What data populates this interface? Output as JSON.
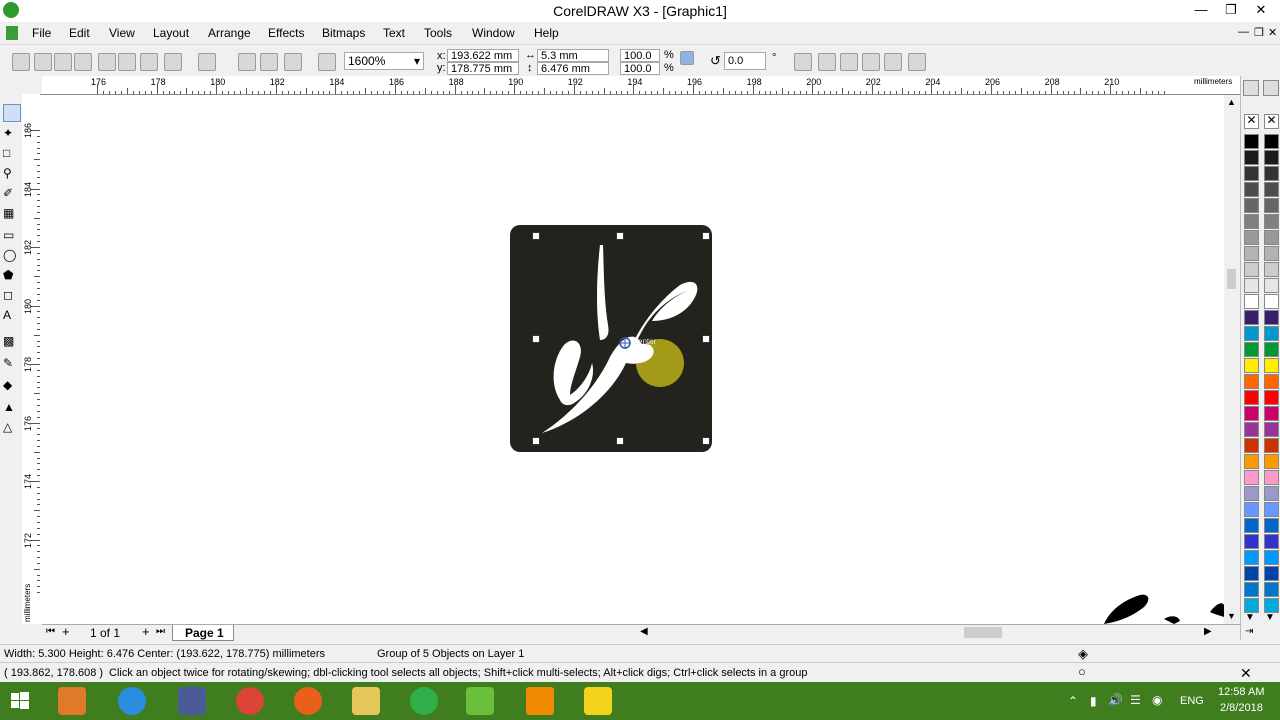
{
  "window": {
    "title": "CorelDRAW X3 - [Graphic1]"
  },
  "menu": [
    "File",
    "Edit",
    "View",
    "Layout",
    "Arrange",
    "Effects",
    "Bitmaps",
    "Text",
    "Tools",
    "Window",
    "Help"
  ],
  "toolbar": {
    "zoom": "1600%",
    "x_label": "x:",
    "x_value": "193.622 mm",
    "y_label": "y:",
    "y_value": "178.775 mm",
    "width_value": "5.3 mm",
    "height_value": "6.476 mm",
    "scale_x": "100.0",
    "scale_y": "100.0",
    "percent": "%",
    "rotation": "0.0",
    "degree": "°"
  },
  "ruler": {
    "unit": "millimeters",
    "h_labels": [
      "176",
      "178",
      "180",
      "182",
      "184",
      "186",
      "188",
      "190",
      "192",
      "194",
      "196",
      "198",
      "200",
      "202",
      "204",
      "206",
      "208",
      "210"
    ],
    "v_labels": [
      "186",
      "184",
      "182",
      "180",
      "178",
      "176",
      "174",
      "172"
    ],
    "v_unit": "millimeters"
  },
  "canvas": {
    "center_label": "center",
    "artwork_bg": "#24221c",
    "dot_color": "#a39a17"
  },
  "pages": {
    "counter": "1 of 1",
    "tab": "Page 1"
  },
  "status": {
    "dimensions": "Width: 5.300  Height: 6.476  Center: (193.622, 178.775)  millimeters",
    "selection": "Group of 5 Objects on Layer 1",
    "cursor": "( 193.862, 178.608 )",
    "hint": "Click an object twice for rotating/skewing; dbl-clicking tool selects all objects; Shift+click multi-selects; Alt+click digs; Ctrl+click selects in a group"
  },
  "taskbar": {
    "lang": "ENG",
    "time": "12:58 AM",
    "date": "2/8/2018"
  },
  "palette": [
    "#000000",
    "#1a1a1a",
    "#333333",
    "#4d4d4d",
    "#666666",
    "#808080",
    "#999999",
    "#b3b3b3",
    "#cccccc",
    "#e6e6e6",
    "#ffffff",
    "#3a1e6e",
    "#0099cc",
    "#009933",
    "#ffee00",
    "#ff6600",
    "#ff0000",
    "#cc0066",
    "#993399",
    "#cc3300",
    "#ff9900",
    "#ff99cc",
    "#9999cc",
    "#6699ff",
    "#0066cc",
    "#3333cc",
    "#0099ff",
    "#0044aa",
    "#0077cc",
    "#00aadd"
  ]
}
